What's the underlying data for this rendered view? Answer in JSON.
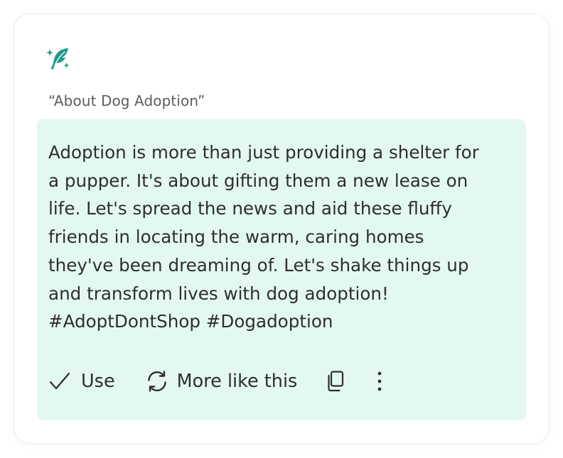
{
  "card": {
    "logo_icon": "feather-sparkle-icon",
    "prompt": "“About Dog Adoption”",
    "result_text": "Adoption is more than just providing a shelter for\na pupper. It's about gifting them a new lease on\nlife. Let's spread the news and aid these fluffy\nfriends in locating the warm, caring homes\nthey've been dreaming of. Let's shake things up\nand transform lives with dog adoption!\n#AdoptDontShop #Dogadoption",
    "actions": {
      "use_label": "Use",
      "use_icon": "checkmark-icon",
      "more_label": "More like this",
      "more_icon": "refresh-icon",
      "copy_icon": "copy-icon",
      "menu_icon": "more-vertical-icon"
    }
  },
  "colors": {
    "accent": "#1a9a8c",
    "result_background": "#e4f8f2",
    "text": "#2e2e2e",
    "muted_text": "#5c5c5c"
  }
}
